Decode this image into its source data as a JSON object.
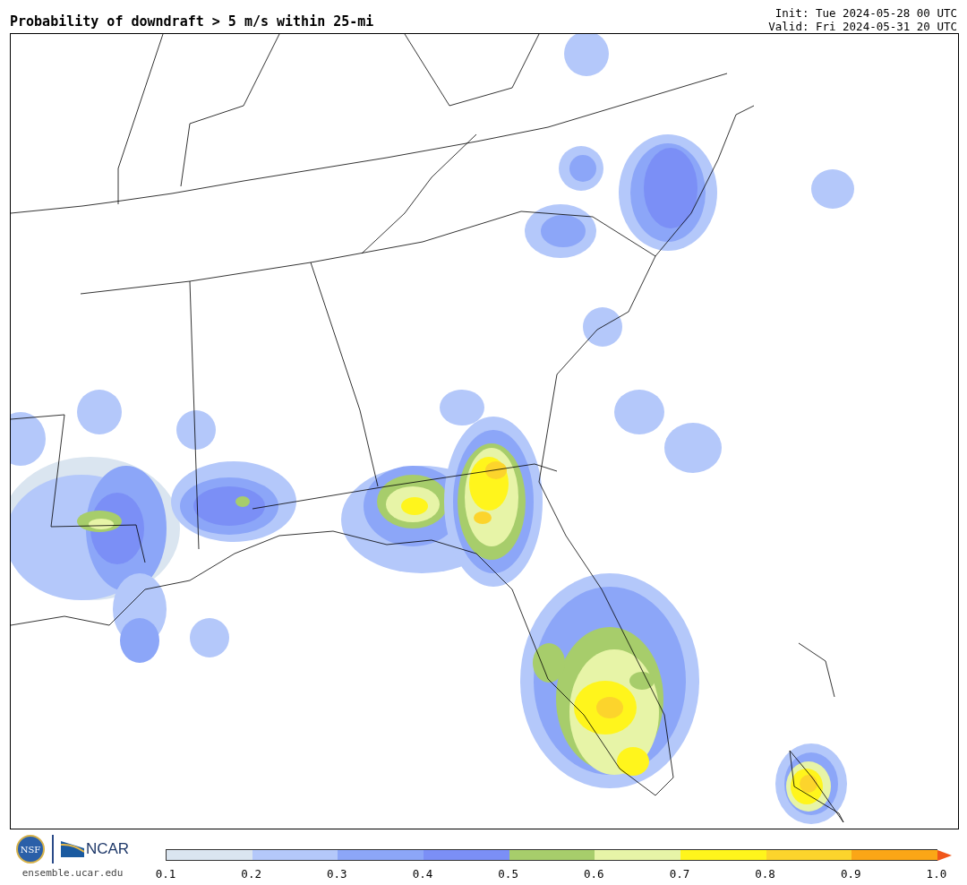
{
  "title": "Probability of downdraft > 5 m/s within 25-mi",
  "init": "Init: Tue 2024-05-28 00 UTC",
  "valid": "Valid: Fri 2024-05-31 20 UTC",
  "logo": {
    "nsf": "NSF",
    "ncar": "NCAR",
    "url": "ensemble.ucar.edu"
  },
  "colorbar": {
    "bins": [
      {
        "color": "#dae5f0"
      },
      {
        "color": "#b4c8fa"
      },
      {
        "color": "#8ca6f8"
      },
      {
        "color": "#7b8ff6"
      },
      {
        "color": "#a7cd6b"
      },
      {
        "color": "#e7f4a7"
      },
      {
        "color": "#fff51c"
      },
      {
        "color": "#fcd42c"
      },
      {
        "color": "#fba616"
      }
    ],
    "extend": {
      "color": "#f0561a"
    },
    "ticks": [
      "0.1",
      "0.2",
      "0.3",
      "0.4",
      "0.5",
      "0.6",
      "0.7",
      "0.8",
      "0.9",
      "1.0"
    ]
  }
}
